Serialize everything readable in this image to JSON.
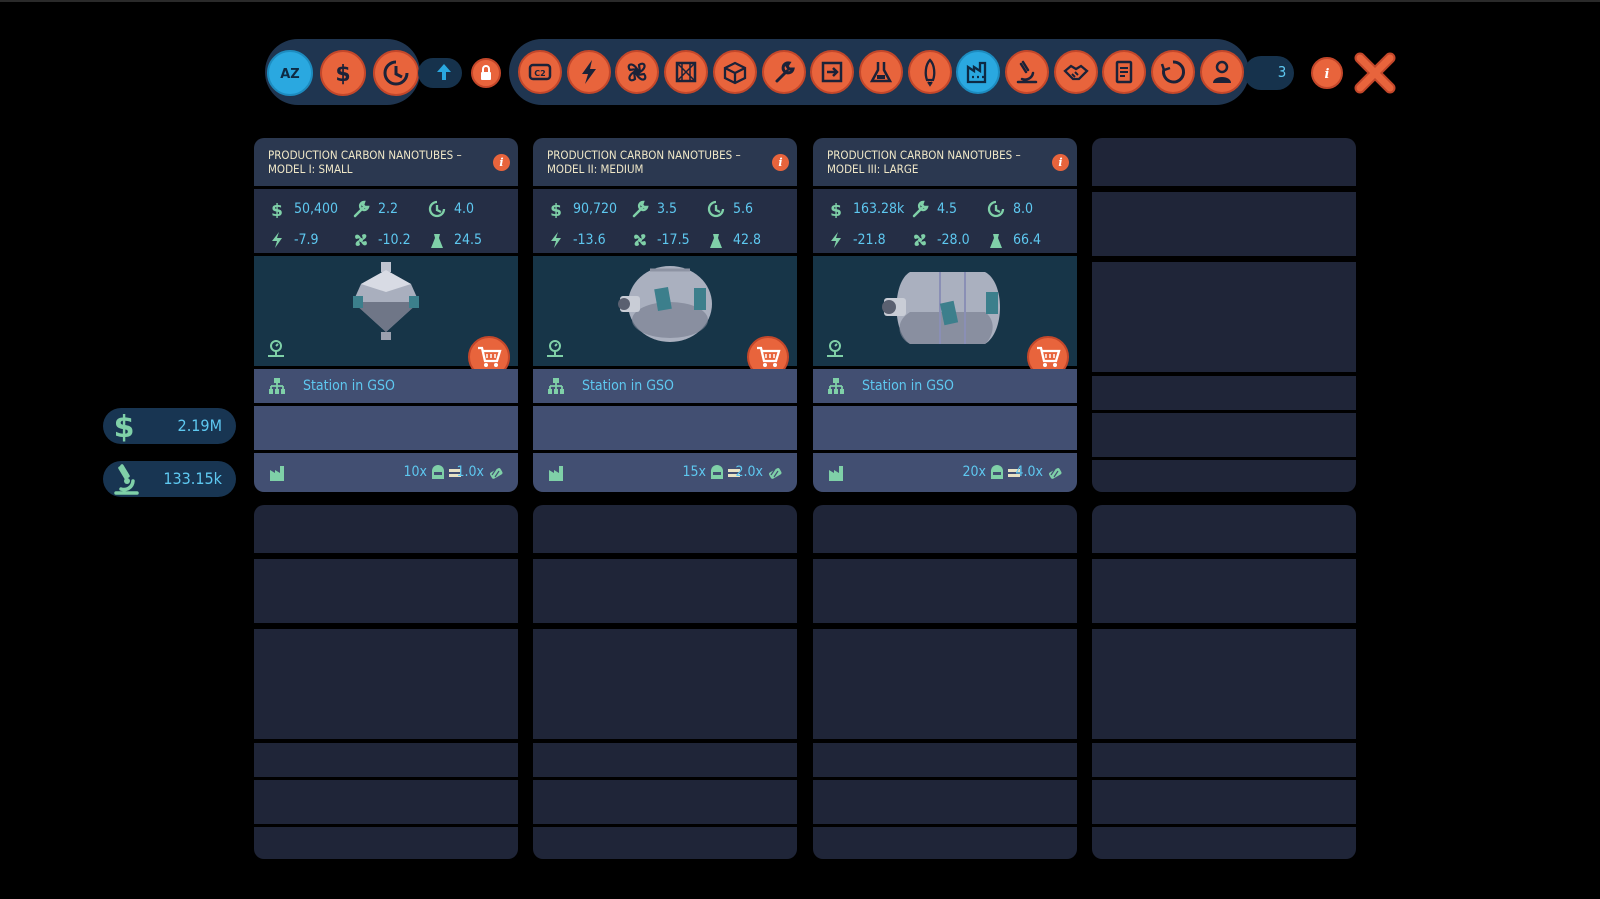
{
  "toolbar": {
    "sort_buttons": [
      {
        "name": "sort-alphabetical-button",
        "icon": "az-icon",
        "label": "AZ",
        "active": true
      },
      {
        "name": "sort-price-button",
        "icon": "dollar-icon"
      },
      {
        "name": "sort-duration-button",
        "icon": "clock-icon"
      }
    ],
    "sort_direction_icon": "arrow-up-icon",
    "lock_icon": "lock-icon",
    "categories": [
      {
        "name": "category-co2",
        "icon": "co2-icon"
      },
      {
        "name": "category-power",
        "icon": "lightning-icon"
      },
      {
        "name": "category-ventilation",
        "icon": "fan-icon"
      },
      {
        "name": "category-structure",
        "icon": "frame-icon"
      },
      {
        "name": "category-storage",
        "icon": "box-icon"
      },
      {
        "name": "category-maintenance",
        "icon": "wrench-icon"
      },
      {
        "name": "category-docking",
        "icon": "dock-icon"
      },
      {
        "name": "category-laboratory",
        "icon": "flask-icon"
      },
      {
        "name": "category-propulsion",
        "icon": "rocket-icon"
      },
      {
        "name": "category-production",
        "icon": "factory-icon",
        "active": true
      },
      {
        "name": "category-research",
        "icon": "microscope-icon"
      },
      {
        "name": "category-trade",
        "icon": "handshake-icon"
      },
      {
        "name": "category-documents",
        "icon": "document-icon"
      },
      {
        "name": "category-recycling",
        "icon": "recycle-icon"
      },
      {
        "name": "category-crew",
        "icon": "astronaut-icon"
      }
    ],
    "result_count": "3",
    "colors": {
      "accent": "#e8643c",
      "active": "#2aa8e0",
      "text": "#5ec8f0"
    }
  },
  "resources": {
    "money": "2.19M",
    "research": "133.15k"
  },
  "cards": [
    {
      "title": "PRODUCTION CARBON NANOTUBES – MODEL I: SMALL",
      "price": "50,400",
      "maintenance": "2.2",
      "build_time": "4.0",
      "power": "-7.9",
      "ventilation": "-10.2",
      "mass": "24.5",
      "location": "Station in GSO",
      "output_multiplier": "10x",
      "efficiency": "1.0x",
      "module_size": "small"
    },
    {
      "title": "PRODUCTION CARBON NANOTUBES – MODEL II: MEDIUM",
      "price": "90,720",
      "maintenance": "3.5",
      "build_time": "5.6",
      "power": "-13.6",
      "ventilation": "-17.5",
      "mass": "42.8",
      "location": "Station in GSO",
      "output_multiplier": "15x",
      "efficiency": "2.0x",
      "module_size": "medium"
    },
    {
      "title": "PRODUCTION CARBON NANOTUBES – MODEL III: LARGE",
      "price": "163.28k",
      "maintenance": "4.5",
      "build_time": "8.0",
      "power": "-21.8",
      "ventilation": "-28.0",
      "mass": "66.4",
      "location": "Station in GSO",
      "output_multiplier": "20x",
      "efficiency": "4.0x",
      "module_size": "large"
    }
  ]
}
